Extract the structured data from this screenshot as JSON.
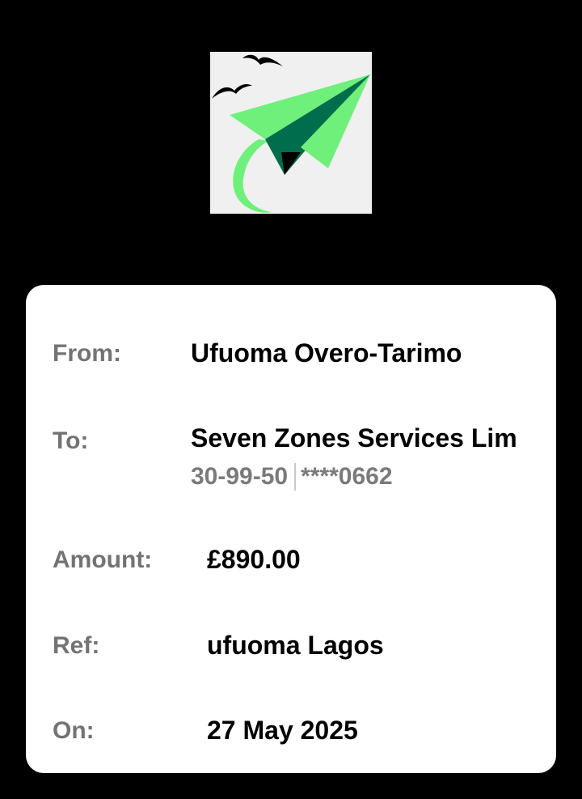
{
  "logo": {
    "icon": "paper-plane-icon",
    "colors": {
      "background": "#f0f0f0",
      "light_green": "#6ef07b",
      "dark_green": "#006e4c",
      "birds": "#000000"
    }
  },
  "receipt": {
    "from": {
      "label": "From:",
      "value": "Ufuoma Overo-Tarimo"
    },
    "to": {
      "label": "To:",
      "value": "Seven Zones Services Lim",
      "sort_code": "30-99-50",
      "account": "****0662"
    },
    "amount": {
      "label": "Amount:",
      "value": "£890.00"
    },
    "ref": {
      "label": "Ref:",
      "value": "ufuoma Lagos"
    },
    "on": {
      "label": "On:",
      "value": "27 May 2025"
    }
  }
}
